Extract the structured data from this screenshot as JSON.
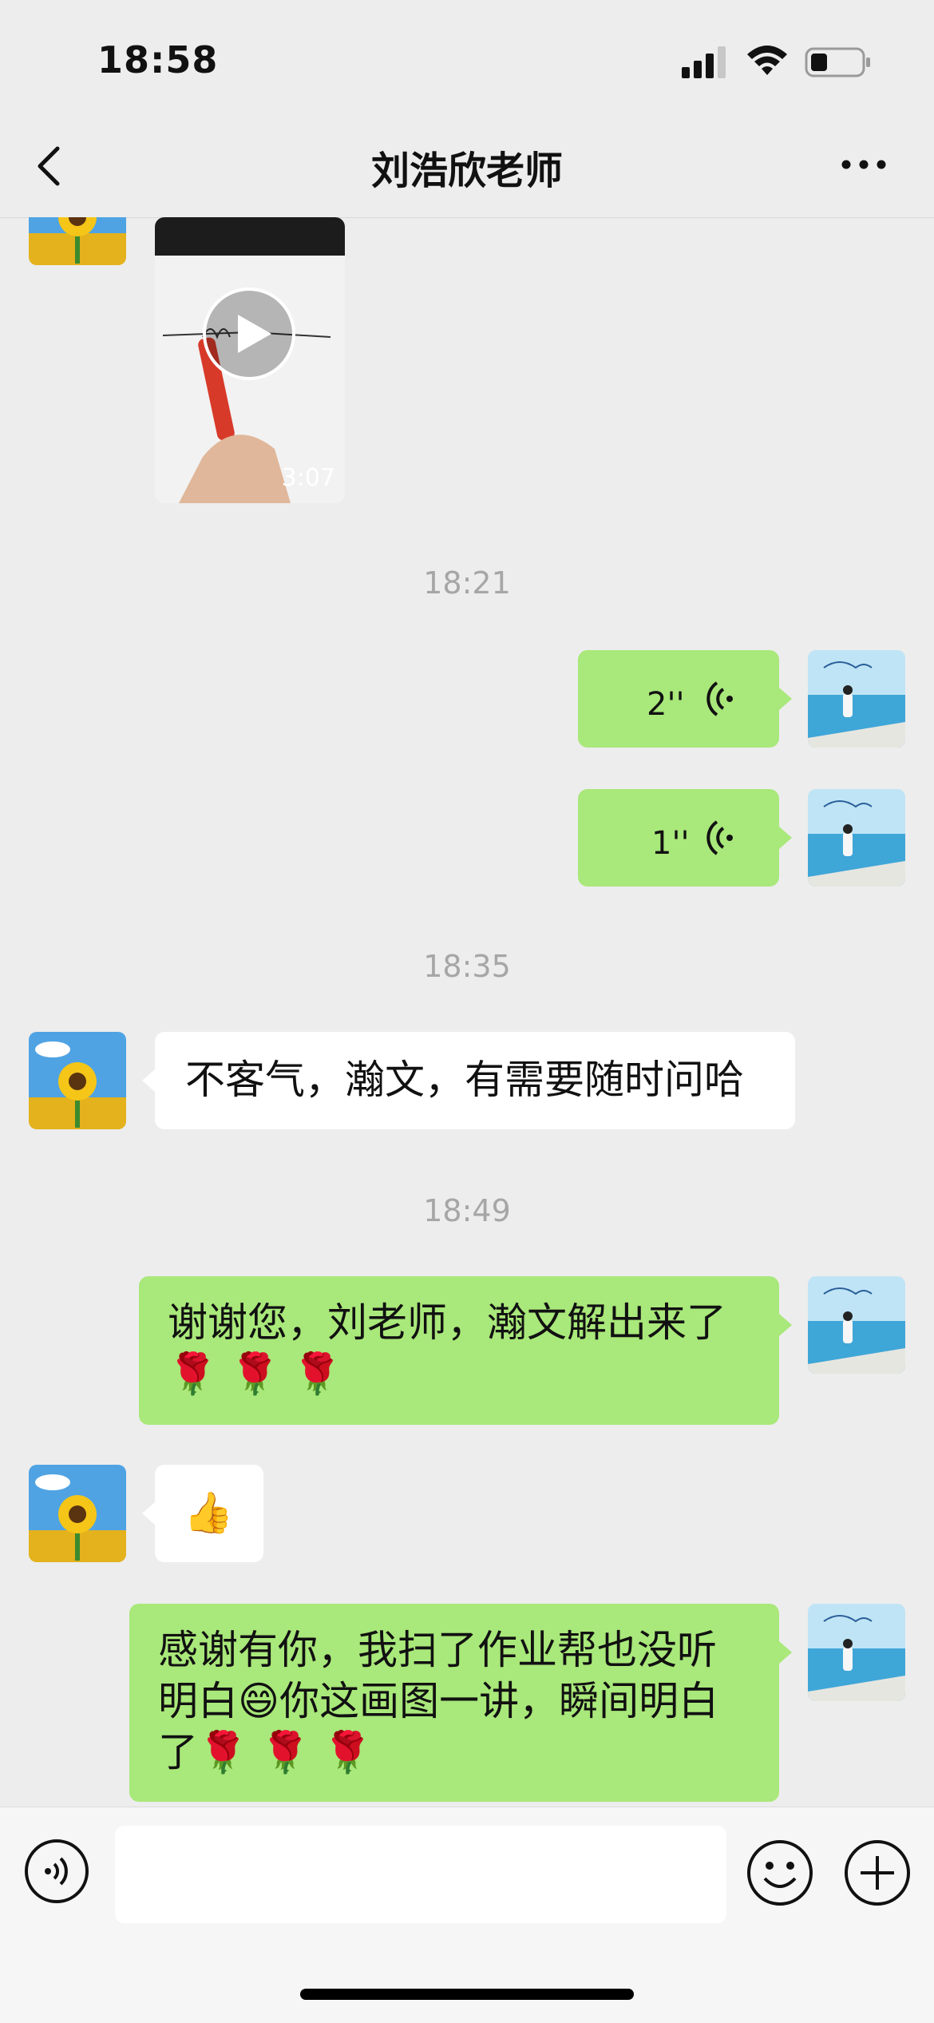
{
  "status_bar": {
    "time": "18:58"
  },
  "nav": {
    "title": "刘浩欣老师"
  },
  "messages": {
    "video_duration": "3:07",
    "time_1821": "18:21",
    "voice_1_len": "2''",
    "voice_2_len": "1''",
    "time_1835": "18:35",
    "msg_them_1": "不客气，瀚文，有需要随时问哈",
    "time_1849": "18:49",
    "msg_me_1_line1": "谢谢您，刘老师，瀚文解出来了",
    "msg_me_1_line2": "🌹 🌹 🌹",
    "msg_them_2": "👍",
    "msg_me_2_line1": "感谢有你，我扫了作业帮也没听",
    "msg_me_2_line2": "明白😄你这画图一讲，瞬间明白",
    "msg_me_2_line3": "了🌹 🌹 🌹"
  },
  "input": {
    "placeholder": ""
  },
  "colors": {
    "my_bubble": "#a9e87a",
    "their_bubble": "#ffffff",
    "background": "#ededed"
  }
}
